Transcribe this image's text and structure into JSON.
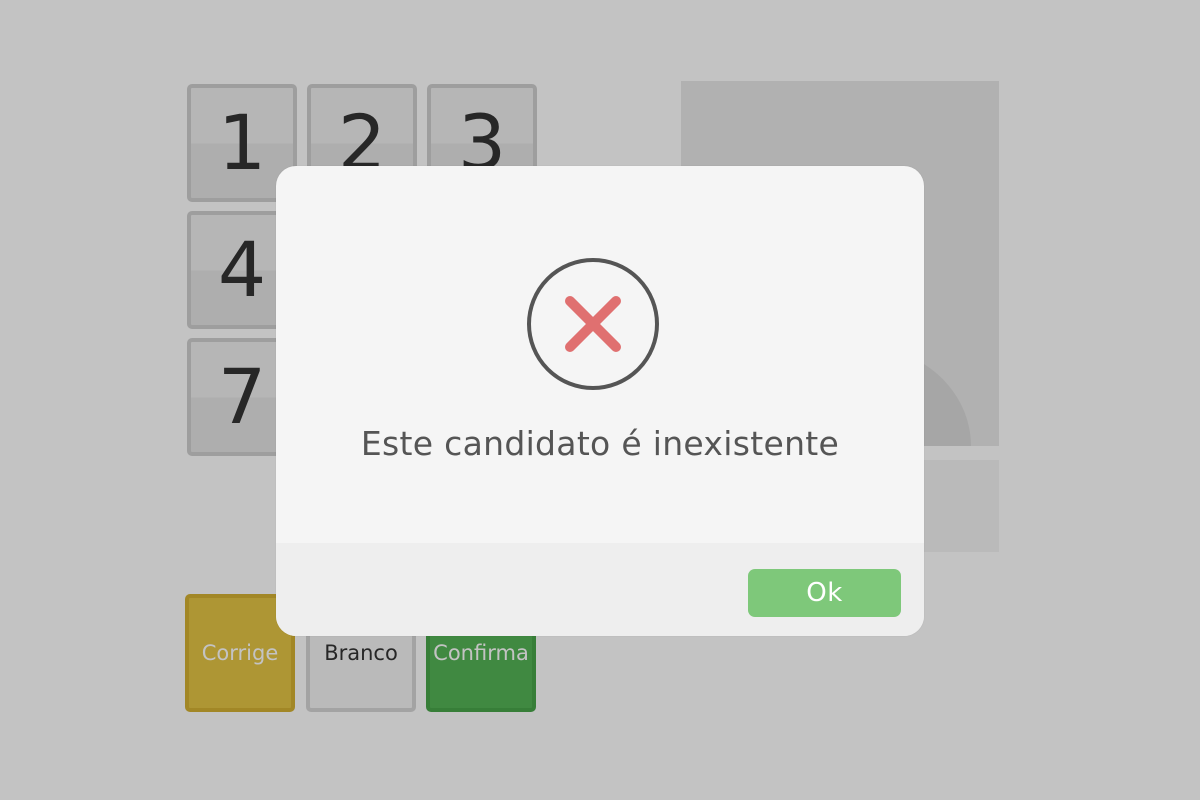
{
  "keypad": {
    "keys": [
      "1",
      "2",
      "3",
      "4",
      "7"
    ],
    "corrige_label": "Corrige",
    "branco_label": "Branco",
    "confirma_label": "Confirma"
  },
  "dialog": {
    "icon": "error-x-icon",
    "message": "Este candidato é inexistente",
    "ok_label": "Ok"
  },
  "colors": {
    "overlay": "rgba(0,0,0,0.235)",
    "dialog_bg": "#f5f5f5",
    "footer_bg": "#eeeeee",
    "ok_button": "#7ec87a",
    "error_x": "#e07070",
    "icon_ring": "#555555",
    "corrige": "#e4c445",
    "confirma": "#54b456"
  }
}
